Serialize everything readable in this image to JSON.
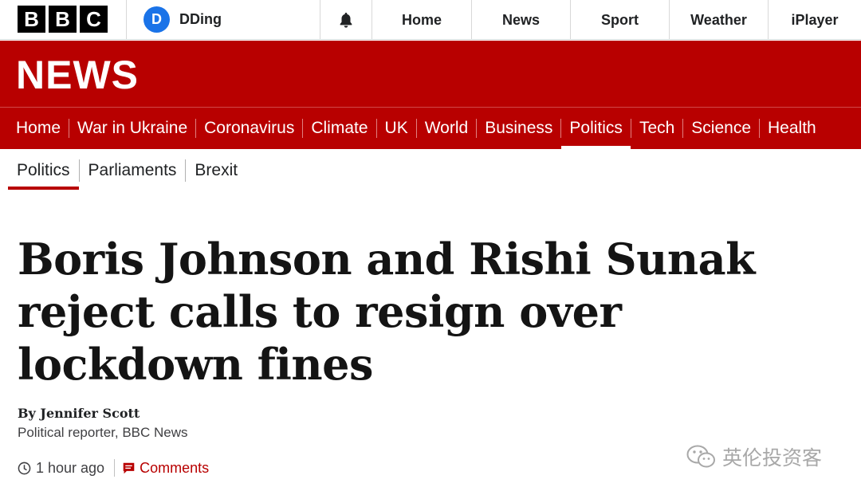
{
  "topbar": {
    "logo_letters": [
      "B",
      "B",
      "C"
    ],
    "account": {
      "initial": "D",
      "name": "DDing"
    },
    "notifications_icon": "bell-icon",
    "nav": [
      "Home",
      "News",
      "Sport",
      "Weather",
      "iPlayer"
    ]
  },
  "banner": {
    "title": "NEWS"
  },
  "section_nav": {
    "items": [
      "Home",
      "War in Ukraine",
      "Coronavirus",
      "Climate",
      "UK",
      "World",
      "Business",
      "Politics",
      "Tech",
      "Science",
      "Health"
    ],
    "active": "Politics"
  },
  "sub_nav": {
    "items": [
      "Politics",
      "Parliaments",
      "Brexit"
    ],
    "active": "Politics"
  },
  "article": {
    "headline": "Boris Johnson and Rishi Sunak reject calls to resign over lockdown fines",
    "byline": "By Jennifer Scott",
    "role": "Political reporter, BBC News",
    "time": "1 hour ago",
    "time_icon": "clock-icon",
    "comments_label": "Comments",
    "comments_icon": "comment-icon"
  },
  "watermark": {
    "text": "英伦投资客",
    "icon": "wechat-icon"
  },
  "colors": {
    "brand_red": "#b80000",
    "avatar_blue": "#1a73e8",
    "text_dark": "#141414"
  }
}
